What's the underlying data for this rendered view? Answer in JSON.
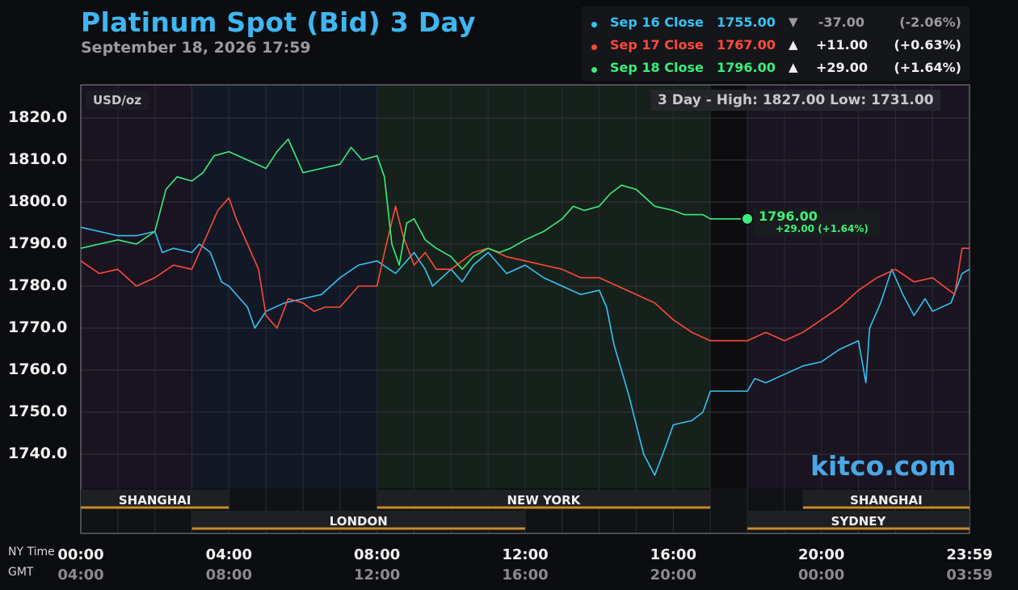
{
  "header": {
    "title": "Platinum Spot (Bid) 3 Day",
    "datetime": "September 18, 2026 17:59"
  },
  "legend": [
    {
      "label": "Sep 16 Close",
      "value": "1755.00",
      "arrow": "▼",
      "change": "-37.00",
      "pct": "(-2.06%)",
      "color": "#33c3f5",
      "dim": true
    },
    {
      "label": "Sep 17 Close",
      "value": "1767.00",
      "arrow": "▲",
      "change": "+11.00",
      "pct": "(+0.63%)",
      "color": "#ff4a3a",
      "dim": false
    },
    {
      "label": "Sep 18 Close",
      "value": "1796.00",
      "arrow": "▲",
      "change": "+29.00",
      "pct": "(+1.64%)",
      "color": "#39ee7c",
      "dim": false
    }
  ],
  "unit_label": "USD/oz",
  "hilo_label": "3 Day - High: 1827.00  Low: 1731.00",
  "watermark": "kitco.com",
  "last_value": "1796.00",
  "last_change": "+29.00 (+1.64%)",
  "axis_labels": {
    "ny": "NY Time",
    "gmt": "GMT"
  },
  "x_ticks": [
    {
      "ny": "00:00",
      "gmt": "04:00"
    },
    {
      "ny": "04:00",
      "gmt": "08:00"
    },
    {
      "ny": "08:00",
      "gmt": "12:00"
    },
    {
      "ny": "12:00",
      "gmt": "16:00"
    },
    {
      "ny": "16:00",
      "gmt": "20:00"
    },
    {
      "ny": "20:00",
      "gmt": "00:00"
    },
    {
      "ny": "23:59",
      "gmt": "03:59"
    }
  ],
  "sessions": [
    {
      "name": "SHANGHAI",
      "start": 0,
      "end": 4,
      "row": 1
    },
    {
      "name": "NEW YORK",
      "start": 8,
      "end": 17,
      "row": 1
    },
    {
      "name": "SHANGHAI",
      "start": 19.5,
      "end": 24,
      "row": 1
    },
    {
      "name": "LONDON",
      "start": 3,
      "end": 12,
      "row": 2
    },
    {
      "name": "SYDNEY",
      "start": 18,
      "end": 24,
      "row": 2
    }
  ],
  "chart_data": {
    "type": "line",
    "title": "Platinum Spot (Bid) 3 Day",
    "xlabel": "NY Time",
    "ylabel": "USD/oz",
    "xlim": [
      0,
      24
    ],
    "ylim": [
      1730,
      1827
    ],
    "y_ticks": [
      1740.0,
      1750.0,
      1760.0,
      1770.0,
      1780.0,
      1790.0,
      1800.0,
      1810.0,
      1820.0
    ],
    "grid": true,
    "legend_position": "top-right",
    "series": [
      {
        "name": "Sep 16 Close",
        "color": "#33c3f5",
        "points": [
          [
            0,
            1794
          ],
          [
            0.5,
            1793
          ],
          [
            1,
            1792
          ],
          [
            1.5,
            1792
          ],
          [
            2,
            1793
          ],
          [
            2.2,
            1788
          ],
          [
            2.5,
            1789
          ],
          [
            3,
            1788
          ],
          [
            3.2,
            1790
          ],
          [
            3.5,
            1788
          ],
          [
            3.8,
            1781
          ],
          [
            4,
            1780
          ],
          [
            4.5,
            1775
          ],
          [
            4.7,
            1770
          ],
          [
            5,
            1774
          ],
          [
            5.5,
            1776
          ],
          [
            6,
            1777
          ],
          [
            6.5,
            1778
          ],
          [
            7,
            1782
          ],
          [
            7.5,
            1785
          ],
          [
            8,
            1786
          ],
          [
            8.5,
            1783
          ],
          [
            9,
            1788
          ],
          [
            9.3,
            1784
          ],
          [
            9.5,
            1780
          ],
          [
            10,
            1784
          ],
          [
            10.3,
            1781
          ],
          [
            10.6,
            1785
          ],
          [
            11,
            1788
          ],
          [
            11.5,
            1783
          ],
          [
            12,
            1785
          ],
          [
            12.5,
            1782
          ],
          [
            13,
            1780
          ],
          [
            13.5,
            1778
          ],
          [
            14,
            1779
          ],
          [
            14.2,
            1775
          ],
          [
            14.4,
            1766
          ],
          [
            14.6,
            1760
          ],
          [
            14.8,
            1754
          ],
          [
            15,
            1747
          ],
          [
            15.2,
            1740
          ],
          [
            15.5,
            1735
          ],
          [
            15.8,
            1742
          ],
          [
            16,
            1747
          ],
          [
            16.5,
            1748
          ],
          [
            16.8,
            1750
          ],
          [
            17,
            1755
          ],
          [
            18,
            1755
          ],
          [
            18.2,
            1758
          ],
          [
            18.5,
            1757
          ],
          [
            19,
            1759
          ],
          [
            19.5,
            1761
          ],
          [
            20,
            1762
          ],
          [
            20.5,
            1765
          ],
          [
            21,
            1767
          ],
          [
            21.2,
            1757
          ],
          [
            21.3,
            1770
          ],
          [
            21.6,
            1776
          ],
          [
            21.9,
            1784
          ],
          [
            22.2,
            1778
          ],
          [
            22.5,
            1773
          ],
          [
            22.8,
            1777
          ],
          [
            23,
            1774
          ],
          [
            23.5,
            1776
          ],
          [
            23.8,
            1783
          ],
          [
            24,
            1784
          ]
        ]
      },
      {
        "name": "Sep 17 Close",
        "color": "#ff4a3a",
        "points": [
          [
            0,
            1786
          ],
          [
            0.5,
            1783
          ],
          [
            1,
            1784
          ],
          [
            1.5,
            1780
          ],
          [
            2,
            1782
          ],
          [
            2.5,
            1785
          ],
          [
            3,
            1784
          ],
          [
            3.2,
            1788
          ],
          [
            3.5,
            1794
          ],
          [
            3.7,
            1798
          ],
          [
            4,
            1801
          ],
          [
            4.2,
            1796
          ],
          [
            4.5,
            1790
          ],
          [
            4.8,
            1784
          ],
          [
            5,
            1773
          ],
          [
            5.3,
            1770
          ],
          [
            5.6,
            1777
          ],
          [
            6,
            1776
          ],
          [
            6.3,
            1774
          ],
          [
            6.6,
            1775
          ],
          [
            7,
            1775
          ],
          [
            7.5,
            1780
          ],
          [
            8,
            1780
          ],
          [
            8.2,
            1788
          ],
          [
            8.5,
            1799
          ],
          [
            8.7,
            1792
          ],
          [
            9,
            1785
          ],
          [
            9.3,
            1788
          ],
          [
            9.6,
            1784
          ],
          [
            10,
            1784
          ],
          [
            10.3,
            1786
          ],
          [
            10.6,
            1788
          ],
          [
            11,
            1789
          ],
          [
            11.5,
            1787
          ],
          [
            12,
            1786
          ],
          [
            12.5,
            1785
          ],
          [
            13,
            1784
          ],
          [
            13.5,
            1782
          ],
          [
            14,
            1782
          ],
          [
            14.5,
            1780
          ],
          [
            15,
            1778
          ],
          [
            15.5,
            1776
          ],
          [
            16,
            1772
          ],
          [
            16.5,
            1769
          ],
          [
            17,
            1767
          ],
          [
            18,
            1767
          ],
          [
            18.5,
            1769
          ],
          [
            19,
            1767
          ],
          [
            19.5,
            1769
          ],
          [
            20,
            1772
          ],
          [
            20.5,
            1775
          ],
          [
            21,
            1779
          ],
          [
            21.5,
            1782
          ],
          [
            22,
            1784
          ],
          [
            22.5,
            1781
          ],
          [
            23,
            1782
          ],
          [
            23.3,
            1780
          ],
          [
            23.6,
            1778
          ],
          [
            23.8,
            1789
          ],
          [
            24,
            1789
          ]
        ]
      },
      {
        "name": "Sep 18 Close",
        "color": "#39ee7c",
        "points": [
          [
            0,
            1789
          ],
          [
            0.5,
            1790
          ],
          [
            1,
            1791
          ],
          [
            1.5,
            1790
          ],
          [
            2,
            1793
          ],
          [
            2.3,
            1803
          ],
          [
            2.6,
            1806
          ],
          [
            3,
            1805
          ],
          [
            3.3,
            1807
          ],
          [
            3.6,
            1811
          ],
          [
            4,
            1812
          ],
          [
            4.5,
            1810
          ],
          [
            5,
            1808
          ],
          [
            5.3,
            1812
          ],
          [
            5.6,
            1815
          ],
          [
            6,
            1807
          ],
          [
            6.5,
            1808
          ],
          [
            7,
            1809
          ],
          [
            7.3,
            1813
          ],
          [
            7.6,
            1810
          ],
          [
            8,
            1811
          ],
          [
            8.2,
            1806
          ],
          [
            8.4,
            1790
          ],
          [
            8.6,
            1785
          ],
          [
            8.8,
            1795
          ],
          [
            9,
            1796
          ],
          [
            9.3,
            1791
          ],
          [
            9.6,
            1789
          ],
          [
            10,
            1787
          ],
          [
            10.3,
            1784
          ],
          [
            10.6,
            1787
          ],
          [
            11,
            1789
          ],
          [
            11.3,
            1788
          ],
          [
            11.6,
            1789
          ],
          [
            12,
            1791
          ],
          [
            12.5,
            1793
          ],
          [
            13,
            1796
          ],
          [
            13.3,
            1799
          ],
          [
            13.6,
            1798
          ],
          [
            14,
            1799
          ],
          [
            14.3,
            1802
          ],
          [
            14.6,
            1804
          ],
          [
            15,
            1803
          ],
          [
            15.5,
            1799
          ],
          [
            16,
            1798
          ],
          [
            16.3,
            1797
          ],
          [
            16.8,
            1797
          ],
          [
            17,
            1796
          ],
          [
            18,
            1796
          ]
        ]
      }
    ]
  }
}
